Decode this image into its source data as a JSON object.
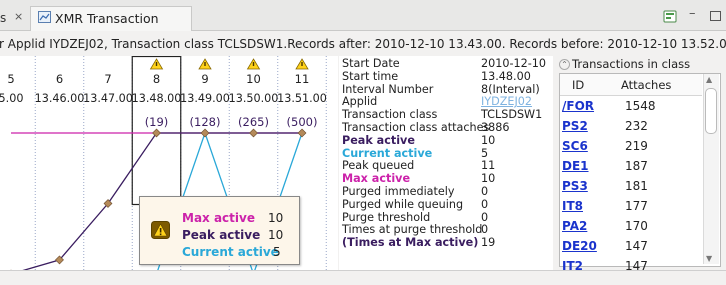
{
  "colors": {
    "max_active": "#cc22aa",
    "peak_active": "#3a1d60",
    "current_active": "#2aa8d8",
    "link": "#1a33cc"
  },
  "tabs": {
    "prev_label": "s",
    "active_title": "XMR Transaction"
  },
  "info_line": "r Applid IYDZEJ02, Transaction class TCLSDSW1.Records after: 2010-12-10 13.43.00. Records before: 2010-12-10 13.52.00.",
  "chart_data": {
    "type": "line",
    "categories": [
      "5",
      "6",
      "7",
      "8",
      "9",
      "10",
      "11"
    ],
    "times": [
      "5.00",
      "13.46.00",
      "13.47.00",
      "13.48.00",
      "13.49.00",
      "13.50.00",
      "13.51.00"
    ],
    "warnings": [
      false,
      false,
      false,
      true,
      true,
      true,
      true
    ],
    "labels": [
      "",
      "",
      "",
      "(19)",
      "(128)",
      "(265)",
      "(500)"
    ],
    "series": [
      {
        "name": "Max active",
        "values": [
          10,
          10,
          10,
          10,
          10,
          10,
          10
        ]
      },
      {
        "name": "Peak active",
        "values": [
          0,
          1,
          5,
          10,
          10,
          10,
          10
        ]
      },
      {
        "name": "Current active",
        "values": [
          0,
          0,
          0,
          0,
          10,
          0,
          10
        ]
      }
    ],
    "selected_index": 3,
    "ylim": [
      0,
      10
    ]
  },
  "details": [
    {
      "label": "Start Date",
      "value": "2010-12-10",
      "style": "normal"
    },
    {
      "label": "Start time",
      "value": "13.48.00",
      "style": "normal"
    },
    {
      "label": "Interval Number",
      "value": "8(Interval)",
      "style": "normal"
    },
    {
      "label": "Applid",
      "value": "IYDZEJ02",
      "style": "link"
    },
    {
      "label": "Transaction class",
      "value": "TCLSDSW1",
      "style": "normal"
    },
    {
      "label": "Transaction class attaches",
      "value": "3886",
      "style": "normal"
    },
    {
      "label": "Peak active",
      "value": "10",
      "style": "peak"
    },
    {
      "label": "Current active",
      "value": "5",
      "style": "current"
    },
    {
      "label": "Peak queued",
      "value": "11",
      "style": "normal"
    },
    {
      "label": "Max active",
      "value": "10",
      "style": "max"
    },
    {
      "label": "Purged immediately",
      "value": "0",
      "style": "normal"
    },
    {
      "label": "Purged while queuing",
      "value": "0",
      "style": "normal"
    },
    {
      "label": "Purge threshold",
      "value": "0",
      "style": "normal"
    },
    {
      "label": "Times at purge threshold",
      "value": "0",
      "style": "normal"
    },
    {
      "label": "(Times at Max active)",
      "value": "19",
      "style": "peak"
    }
  ],
  "transactions": {
    "title": "Transactions in class",
    "col_id": "ID",
    "col_attaches": "Attaches",
    "rows": [
      {
        "id": "/FOR",
        "attaches": "1548"
      },
      {
        "id": "PS2",
        "attaches": "232"
      },
      {
        "id": "SC6",
        "attaches": "219"
      },
      {
        "id": "DE1",
        "attaches": "187"
      },
      {
        "id": "PS3",
        "attaches": "181"
      },
      {
        "id": "IT8",
        "attaches": "177"
      },
      {
        "id": "PA2",
        "attaches": "170"
      },
      {
        "id": "DE20",
        "attaches": "147"
      },
      {
        "id": "IT2",
        "attaches": "147"
      }
    ]
  },
  "tooltip": {
    "rows": [
      {
        "label": "Max active",
        "value": "10",
        "style": "max"
      },
      {
        "label": "Peak active",
        "value": "10",
        "style": "peak"
      },
      {
        "label": "Current active",
        "value": "5",
        "style": "current"
      }
    ]
  }
}
